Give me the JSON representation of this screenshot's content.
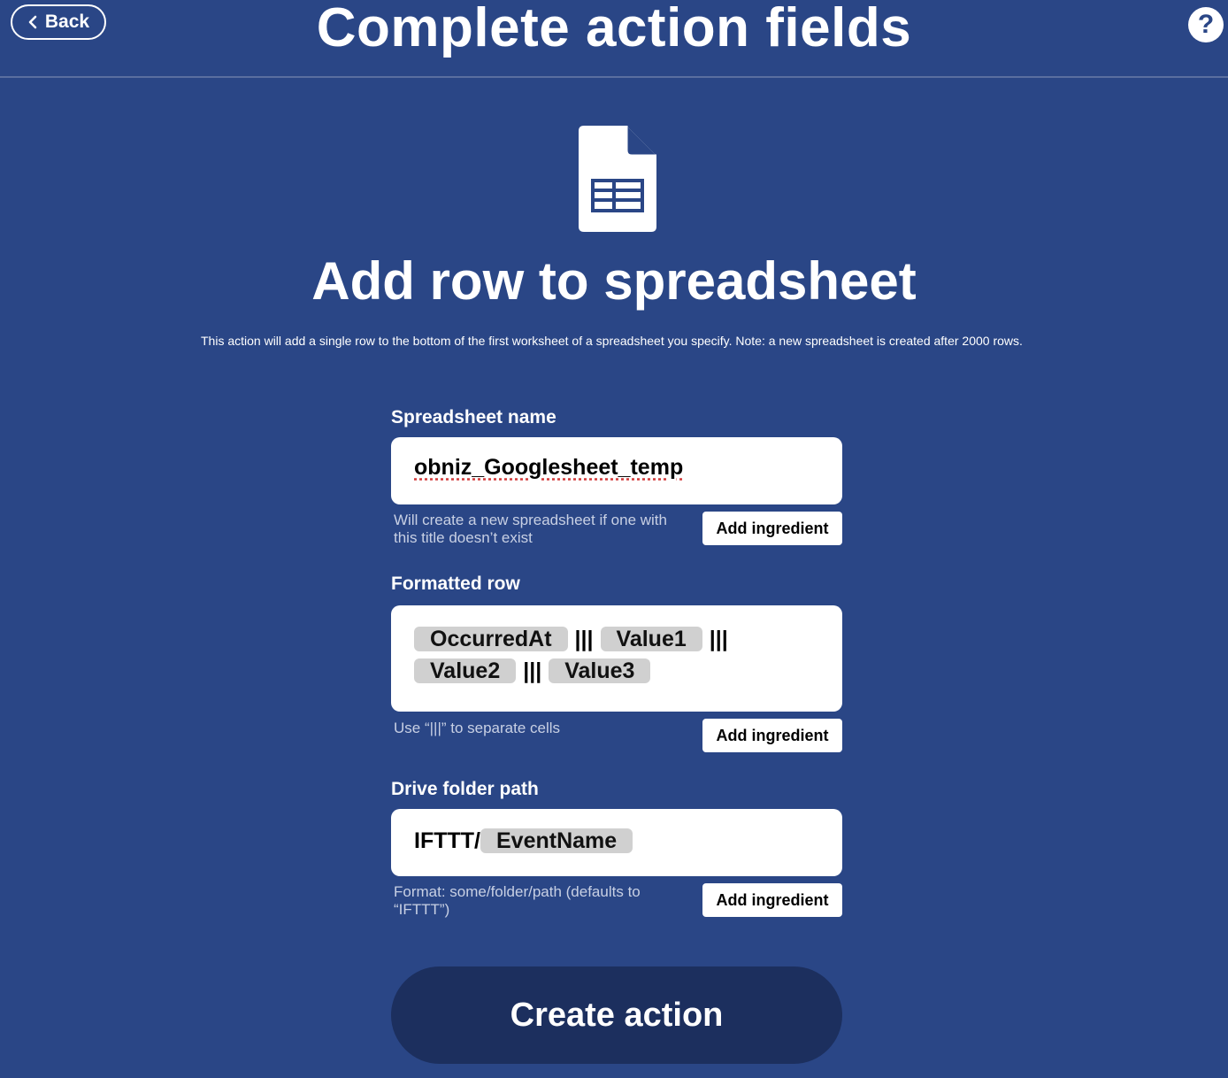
{
  "header": {
    "back_label": "Back",
    "title": "Complete action fields",
    "help_label": "?"
  },
  "service_icon": "google-sheets-icon",
  "action": {
    "title": "Add row to spreadsheet",
    "description": "This action will add a single row to the bottom of the first worksheet of a spreadsheet you specify. Note: a new spreadsheet is created after 2000 rows."
  },
  "fields": {
    "spreadsheet_name": {
      "label": "Spreadsheet name",
      "value": "obniz_Googlesheet_temp",
      "helper": "Will create a new spreadsheet if one with this title doesn’t exist",
      "button": "Add ingredient"
    },
    "formatted_row": {
      "label": "Formatted row",
      "ingredients": [
        "OccurredAt",
        "Value1",
        "Value2",
        "Value3"
      ],
      "separator": "|||",
      "helper": "Use “|||” to separate cells",
      "button": "Add ingredient"
    },
    "drive_folder_path": {
      "label": "Drive folder path",
      "prefix": "IFTTT/",
      "ingredient": "EventName",
      "helper": "Format: some/folder/path (defaults to “IFTTT”)",
      "button": "Add ingredient"
    }
  },
  "submit_label": "Create action",
  "colors": {
    "background": "#2a4686",
    "submit_button": "#1c2f5e",
    "ingredient_pill": "#d0d0d0"
  }
}
